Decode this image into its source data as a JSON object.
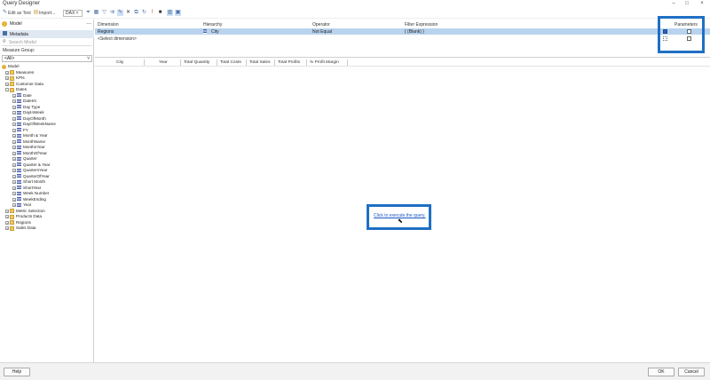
{
  "window": {
    "title": "Query Designer",
    "minimize": "–",
    "maximize": "□",
    "close": "×"
  },
  "toolbar": {
    "edit_as_text": "Edit as Text",
    "import": "Import...",
    "mode": "DAX",
    "icons": [
      "funnel-icon",
      "table-icon",
      "filter-icon",
      "add-filter-icon",
      "edit-icon",
      "delete-icon",
      "copy-icon",
      "refresh-icon",
      "exclamation-icon",
      "stop-icon",
      "calc-icon",
      "results-icon"
    ]
  },
  "left_pane": {
    "model_label": "Model",
    "metadata_tab": "Metadata",
    "search_placeholder": "Search Model",
    "measure_group_label": "Measure Group:",
    "measure_group_value": "<All>",
    "tree": [
      {
        "label": "Model",
        "level": 0,
        "icon": "model",
        "exp": ""
      },
      {
        "label": "Measures",
        "level": 1,
        "icon": "folder",
        "exp": "+"
      },
      {
        "label": "KPIs",
        "level": 1,
        "icon": "folder",
        "exp": "+"
      },
      {
        "label": "Customer Data",
        "level": 1,
        "icon": "folder",
        "exp": "+"
      },
      {
        "label": "Dates",
        "level": 1,
        "icon": "folder",
        "exp": "-"
      },
      {
        "label": "Date",
        "level": 2,
        "icon": "attr",
        "exp": "+"
      },
      {
        "label": "DateInt",
        "level": 2,
        "icon": "attr",
        "exp": "+"
      },
      {
        "label": "Day Type",
        "level": 2,
        "icon": "attr",
        "exp": "+"
      },
      {
        "label": "DayInWeek",
        "level": 2,
        "icon": "attr",
        "exp": "+"
      },
      {
        "label": "DayOfMonth",
        "level": 2,
        "icon": "attr",
        "exp": "+"
      },
      {
        "label": "DayOfWeekName",
        "level": 2,
        "icon": "attr",
        "exp": "+"
      },
      {
        "label": "FY",
        "level": 2,
        "icon": "attr",
        "exp": "+"
      },
      {
        "label": "Month & Year",
        "level": 2,
        "icon": "attr",
        "exp": "+"
      },
      {
        "label": "MonthName",
        "level": 2,
        "icon": "attr",
        "exp": "+"
      },
      {
        "label": "MonthnYear",
        "level": 2,
        "icon": "attr",
        "exp": "+"
      },
      {
        "label": "MonthOfYear",
        "level": 2,
        "icon": "attr",
        "exp": "+"
      },
      {
        "label": "Quarter",
        "level": 2,
        "icon": "attr",
        "exp": "+"
      },
      {
        "label": "Quarter & Year",
        "level": 2,
        "icon": "attr",
        "exp": "+"
      },
      {
        "label": "QuarternYear",
        "level": 2,
        "icon": "attr",
        "exp": "+"
      },
      {
        "label": "QuarterOfYear",
        "level": 2,
        "icon": "attr",
        "exp": "+"
      },
      {
        "label": "Short Month",
        "level": 2,
        "icon": "attr",
        "exp": "+"
      },
      {
        "label": "ShortYear",
        "level": 2,
        "icon": "attr",
        "exp": "+"
      },
      {
        "label": "Week Number",
        "level": 2,
        "icon": "attr",
        "exp": "+"
      },
      {
        "label": "WeekEnding",
        "level": 2,
        "icon": "attr",
        "exp": "+"
      },
      {
        "label": "Year",
        "level": 2,
        "icon": "attr",
        "exp": "+"
      },
      {
        "label": "Metric Selection",
        "level": 1,
        "icon": "folder",
        "exp": "+"
      },
      {
        "label": "Products Data",
        "level": 1,
        "icon": "folder",
        "exp": "+"
      },
      {
        "label": "Regions",
        "level": 1,
        "icon": "folder",
        "exp": "+"
      },
      {
        "label": "Sales Data",
        "level": 1,
        "icon": "folder",
        "exp": "+"
      }
    ]
  },
  "filter_grid": {
    "headers": {
      "dimension": "Dimension",
      "hierarchy": "Hierarchy",
      "operator": "Operator",
      "filter_expression": "Filter Expression",
      "parameters": "Parameters"
    },
    "row": {
      "dimension": "Regions",
      "hierarchy": "City",
      "operator": "Not Equal",
      "filter_expression": "{ (Blank) }"
    },
    "select_dimension": "<Select dimension>"
  },
  "results": {
    "columns": [
      "City",
      "Year",
      "Total Quantity",
      "Total Costs",
      "Total Sales",
      "Total Profits",
      "% Profit Margin"
    ],
    "execute_link": "Click to execute the query."
  },
  "footer": {
    "help": "Help",
    "ok": "OK",
    "cancel": "Cancel"
  },
  "colors": {
    "highlight": "#1f6fc3",
    "selected_row": "#b9d3ee",
    "link": "#1a56c4"
  }
}
